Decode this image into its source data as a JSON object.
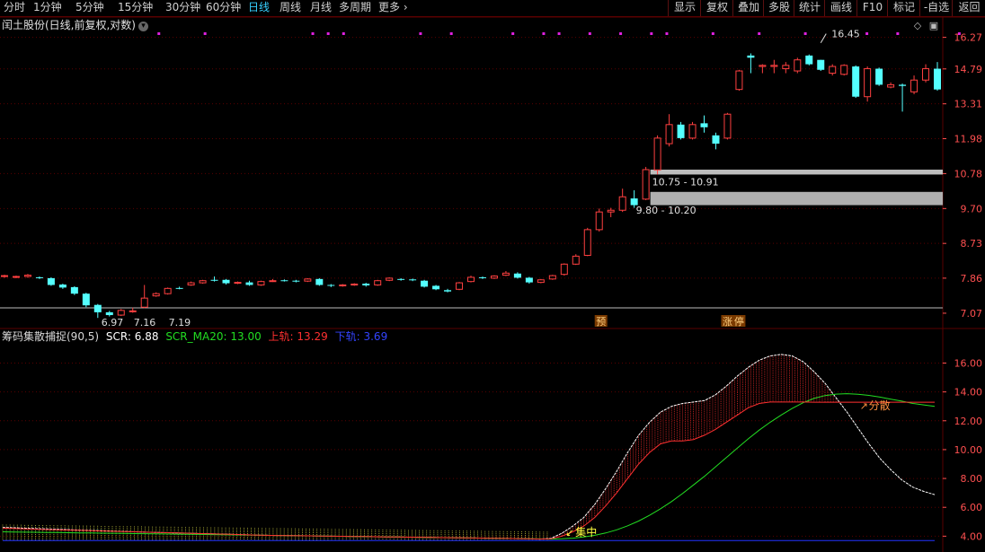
{
  "toolbar": {
    "periods": [
      "分时",
      "1分钟",
      "5分钟",
      "15分钟",
      "30分钟",
      "60分钟",
      "日线",
      "周线",
      "月线",
      "多周期",
      "更多"
    ],
    "active_period": "日线",
    "more_arrow": "›",
    "right_buttons": [
      "显示",
      "复权",
      "叠加",
      "多股",
      "统计",
      "画线",
      "F10",
      "标记",
      "-自选",
      "返回"
    ]
  },
  "stock_title": "闰土股份(日线,前复权,对数)",
  "indicator": {
    "name": "筹码集散捕捉(90,5)",
    "scr_label": "SCR:",
    "scr_value": "6.88",
    "ma_label": "SCR_MA20:",
    "ma_value": "13.00",
    "upper_label": "上轨:",
    "upper_value": "13.29",
    "lower_label": "下轨:",
    "lower_value": "3.69"
  },
  "colors": {
    "up": "#ff4040",
    "down": "#54ffff",
    "grid": "#5a0000",
    "axis_text": "#ff5050",
    "scr": "#ffffff",
    "ma": "#22dd22",
    "upper": "#ff3030",
    "lower": "#2233ff",
    "marker": "#e020e0"
  },
  "chart_data": [
    {
      "type": "candlestick",
      "scale": "log",
      "yticks": [
        "16.27",
        "14.79",
        "13.31",
        "11.98",
        "10.78",
        "9.70",
        "8.73",
        "7.86",
        "7.07"
      ],
      "ylim": [
        7.05,
        16.7
      ],
      "candles": [
        [
          7.9,
          7.92,
          7.87,
          7.94
        ],
        [
          7.88,
          7.9,
          7.86,
          7.92
        ],
        [
          7.9,
          7.93,
          7.87,
          7.96
        ],
        [
          7.88,
          7.86,
          7.84,
          7.9
        ],
        [
          7.86,
          7.7,
          7.68,
          7.88
        ],
        [
          7.71,
          7.64,
          7.61,
          7.73
        ],
        [
          7.65,
          7.5,
          7.47,
          7.67
        ],
        [
          7.5,
          7.24,
          7.2,
          7.52
        ],
        [
          7.25,
          7.09,
          6.97,
          7.27
        ],
        [
          7.09,
          7.03,
          7.0,
          7.12
        ],
        [
          7.03,
          7.13,
          7.01,
          7.16
        ],
        [
          7.12,
          7.12,
          7.08,
          7.19
        ],
        [
          7.2,
          7.4,
          7.18,
          7.7
        ],
        [
          7.45,
          7.5,
          7.43,
          7.53
        ],
        [
          7.5,
          7.62,
          7.48,
          7.64
        ],
        [
          7.63,
          7.62,
          7.6,
          7.66
        ],
        [
          7.7,
          7.75,
          7.68,
          7.78
        ],
        [
          7.75,
          7.8,
          7.73,
          7.82
        ],
        [
          7.82,
          7.81,
          7.78,
          7.9
        ],
        [
          7.82,
          7.74,
          7.71,
          7.84
        ],
        [
          7.74,
          7.76,
          7.72,
          7.78
        ],
        [
          7.76,
          7.7,
          7.68,
          7.8
        ],
        [
          7.7,
          7.78,
          7.68,
          7.8
        ],
        [
          7.79,
          7.8,
          7.77,
          7.84
        ],
        [
          7.81,
          7.8,
          7.78,
          7.83
        ],
        [
          7.8,
          7.79,
          7.76,
          7.82
        ],
        [
          7.79,
          7.84,
          7.77,
          7.86
        ],
        [
          7.84,
          7.7,
          7.68,
          7.86
        ],
        [
          7.7,
          7.68,
          7.65,
          7.72
        ],
        [
          7.68,
          7.7,
          7.66,
          7.72
        ],
        [
          7.7,
          7.72,
          7.68,
          7.74
        ],
        [
          7.73,
          7.69,
          7.66,
          7.75
        ],
        [
          7.7,
          7.8,
          7.68,
          7.82
        ],
        [
          7.81,
          7.86,
          7.79,
          7.88
        ],
        [
          7.84,
          7.82,
          7.8,
          7.86
        ],
        [
          7.83,
          7.81,
          7.79,
          7.85
        ],
        [
          7.8,
          7.66,
          7.64,
          7.82
        ],
        [
          7.68,
          7.6,
          7.58,
          7.7
        ],
        [
          7.58,
          7.55,
          7.53,
          7.61
        ],
        [
          7.6,
          7.75,
          7.58,
          7.77
        ],
        [
          7.78,
          7.88,
          7.76,
          7.92
        ],
        [
          7.88,
          7.86,
          7.84,
          7.9
        ],
        [
          7.86,
          7.91,
          7.84,
          7.93
        ],
        [
          7.93,
          7.98,
          7.91,
          8.03
        ],
        [
          7.97,
          7.87,
          7.85,
          8.0
        ],
        [
          7.87,
          7.76,
          7.73,
          7.89
        ],
        [
          7.76,
          7.82,
          7.74,
          7.84
        ],
        [
          7.84,
          7.92,
          7.82,
          7.94
        ],
        [
          7.95,
          8.2,
          7.92,
          8.22
        ],
        [
          8.2,
          8.4,
          8.18,
          8.45
        ],
        [
          8.42,
          9.1,
          8.4,
          9.15
        ],
        [
          9.1,
          9.6,
          9.05,
          9.7
        ],
        [
          9.6,
          9.65,
          9.45,
          9.72
        ],
        [
          9.65,
          10.05,
          9.6,
          10.3
        ],
        [
          10.0,
          9.8,
          9.72,
          10.25
        ],
        [
          9.98,
          10.91,
          9.95,
          11.0
        ],
        [
          10.9,
          12.0,
          10.75,
          12.1
        ],
        [
          11.8,
          12.5,
          11.7,
          12.9
        ],
        [
          12.5,
          12.0,
          11.95,
          12.6
        ],
        [
          12.0,
          12.5,
          11.95,
          12.6
        ],
        [
          12.55,
          12.4,
          12.2,
          12.85
        ],
        [
          12.1,
          11.8,
          11.6,
          12.2
        ],
        [
          12.0,
          12.9,
          11.95,
          12.95
        ],
        [
          13.9,
          14.7,
          13.85,
          14.75
        ],
        [
          15.4,
          15.3,
          14.6,
          15.5
        ],
        [
          14.9,
          14.95,
          14.6,
          15.0
        ],
        [
          14.9,
          14.95,
          14.6,
          15.2
        ],
        [
          14.8,
          14.95,
          14.6,
          15.1
        ],
        [
          14.7,
          15.2,
          14.6,
          15.3
        ],
        [
          15.4,
          15.0,
          14.95,
          15.45
        ],
        [
          15.2,
          14.75,
          14.7,
          15.2
        ],
        [
          14.6,
          14.9,
          14.5,
          15.0
        ],
        [
          14.55,
          14.95,
          14.5,
          15.0
        ],
        [
          14.9,
          13.6,
          13.55,
          14.95
        ],
        [
          13.6,
          14.8,
          13.4,
          14.9
        ],
        [
          14.8,
          14.1,
          14.05,
          14.85
        ],
        [
          14.0,
          14.1,
          13.95,
          14.2
        ],
        [
          14.1,
          14.05,
          13.0,
          14.15
        ],
        [
          13.8,
          14.3,
          13.7,
          14.5
        ],
        [
          14.3,
          14.8,
          14.2,
          15.0
        ],
        [
          14.8,
          13.9,
          13.85,
          15.1
        ]
      ],
      "annotations": {
        "high_label": "16.45",
        "low_label": "6.97",
        "low_values": [
          "7.16",
          "7.19"
        ],
        "zone_upper_label": "10.75 - 10.91",
        "zone_lower_label": "9.80 - 10.20",
        "zone_upper": [
          10.75,
          10.91
        ],
        "zone_lower": [
          9.8,
          10.2
        ],
        "signal_yu": "预",
        "signal_zt": "涨",
        "signal_ting": "停"
      }
    },
    {
      "type": "line",
      "yticks": [
        "16.00",
        "14.00",
        "12.00",
        "10.00",
        "8.00",
        "6.00",
        "4.00"
      ],
      "ylim": [
        3.4,
        17.4
      ],
      "series": [
        {
          "name": "SCR",
          "values": [
            4.6,
            4.58,
            4.55,
            4.52,
            4.5,
            4.48,
            4.45,
            4.42,
            4.4,
            4.38,
            4.35,
            4.33,
            4.3,
            4.28,
            4.26,
            4.24,
            4.22,
            4.2,
            4.18,
            4.16,
            4.14,
            4.12,
            4.1,
            4.08,
            4.06,
            4.05,
            4.04,
            4.03,
            4.02,
            4.01,
            4.0,
            3.99,
            3.98,
            3.97,
            3.96,
            3.95,
            3.94,
            3.93,
            3.92,
            3.91,
            3.9,
            3.89,
            3.88,
            3.87,
            3.86,
            3.85,
            3.84,
            3.83,
            3.82,
            3.8,
            3.85,
            4.2,
            4.7,
            5.3,
            6.2,
            7.3,
            8.5,
            9.8,
            11.0,
            11.9,
            12.6,
            13.0,
            13.2,
            13.3,
            13.4,
            13.8,
            14.4,
            15.1,
            15.7,
            16.2,
            16.5,
            16.6,
            16.5,
            16.1,
            15.4,
            14.6,
            13.6,
            12.6,
            11.5,
            10.4,
            9.4,
            8.6,
            7.9,
            7.4,
            7.1,
            6.88
          ]
        },
        {
          "name": "SCR_MA20",
          "values": [
            4.3,
            4.29,
            4.28,
            4.27,
            4.26,
            4.25,
            4.24,
            4.23,
            4.22,
            4.21,
            4.2,
            4.19,
            4.18,
            4.17,
            4.16,
            4.15,
            4.14,
            4.13,
            4.12,
            4.11,
            4.1,
            4.09,
            4.08,
            4.07,
            4.06,
            4.05,
            4.04,
            4.03,
            4.02,
            4.01,
            4.0,
            3.99,
            3.98,
            3.97,
            3.96,
            3.95,
            3.94,
            3.93,
            3.92,
            3.91,
            3.9,
            3.89,
            3.88,
            3.87,
            3.86,
            3.85,
            3.84,
            3.83,
            3.82,
            3.81,
            3.8,
            3.82,
            3.86,
            3.94,
            4.06,
            4.22,
            4.44,
            4.72,
            5.05,
            5.45,
            5.9,
            6.4,
            6.95,
            7.55,
            8.15,
            8.8,
            9.45,
            10.1,
            10.75,
            11.35,
            11.9,
            12.4,
            12.85,
            13.25,
            13.55,
            13.75,
            13.85,
            13.88,
            13.84,
            13.76,
            13.64,
            13.5,
            13.36,
            13.2,
            13.1,
            13.0
          ]
        },
        {
          "name": "上轨",
          "values": [
            4.55,
            4.53,
            4.5,
            4.48,
            4.46,
            4.44,
            4.42,
            4.4,
            4.38,
            4.36,
            4.34,
            4.32,
            4.3,
            4.28,
            4.26,
            4.24,
            4.22,
            4.2,
            4.18,
            4.16,
            4.14,
            4.12,
            4.1,
            4.08,
            4.06,
            4.05,
            4.04,
            4.03,
            4.02,
            4.01,
            4.0,
            3.99,
            3.98,
            3.97,
            3.96,
            3.95,
            3.94,
            3.93,
            3.92,
            3.91,
            3.9,
            3.89,
            3.88,
            3.87,
            3.86,
            3.85,
            3.84,
            3.83,
            3.82,
            3.8,
            3.82,
            4.0,
            4.3,
            4.7,
            5.3,
            6.1,
            7.0,
            8.0,
            9.0,
            9.8,
            10.4,
            10.6,
            10.6,
            10.7,
            11.0,
            11.4,
            11.9,
            12.4,
            12.9,
            13.2,
            13.3,
            13.3,
            13.3,
            13.3,
            13.29,
            13.29,
            13.29,
            13.29,
            13.29,
            13.29,
            13.29,
            13.29,
            13.29,
            13.29,
            13.29,
            13.29
          ]
        },
        {
          "name": "下轨",
          "values": [
            3.69,
            3.69,
            3.69,
            3.69,
            3.69,
            3.69,
            3.69,
            3.69,
            3.69,
            3.69,
            3.69,
            3.69,
            3.69,
            3.69,
            3.69,
            3.69,
            3.69,
            3.69,
            3.69,
            3.69,
            3.69,
            3.69,
            3.69,
            3.69,
            3.69,
            3.69,
            3.69,
            3.69,
            3.69,
            3.69,
            3.69,
            3.69,
            3.69,
            3.69,
            3.69,
            3.69,
            3.69,
            3.69,
            3.69,
            3.69,
            3.69,
            3.69,
            3.69,
            3.69,
            3.69,
            3.69,
            3.69,
            3.69,
            3.69,
            3.69,
            3.69,
            3.69,
            3.69,
            3.69,
            3.69,
            3.69,
            3.69,
            3.69,
            3.69,
            3.69,
            3.69,
            3.69,
            3.69,
            3.69,
            3.69,
            3.69,
            3.69,
            3.69,
            3.69,
            3.69,
            3.69,
            3.69,
            3.69,
            3.69,
            3.69,
            3.69,
            3.69,
            3.69,
            3.69,
            3.69,
            3.69,
            3.69,
            3.69,
            3.69,
            3.69,
            3.69
          ]
        }
      ],
      "annotations": {
        "concentrate": "集中",
        "disperse": "分散"
      }
    }
  ]
}
